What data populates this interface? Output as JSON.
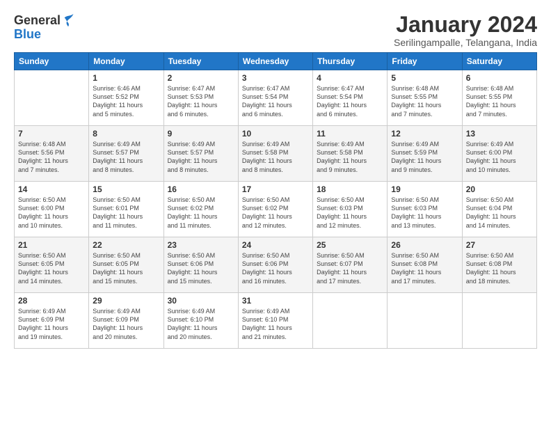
{
  "header": {
    "logo": {
      "general": "General",
      "blue": "Blue"
    },
    "month_title": "January 2024",
    "subtitle": "Serilingampalle, Telangana, India"
  },
  "days_of_week": [
    "Sunday",
    "Monday",
    "Tuesday",
    "Wednesday",
    "Thursday",
    "Friday",
    "Saturday"
  ],
  "weeks": [
    [
      {
        "day": "",
        "info": ""
      },
      {
        "day": "1",
        "info": "Sunrise: 6:46 AM\nSunset: 5:52 PM\nDaylight: 11 hours\nand 5 minutes."
      },
      {
        "day": "2",
        "info": "Sunrise: 6:47 AM\nSunset: 5:53 PM\nDaylight: 11 hours\nand 6 minutes."
      },
      {
        "day": "3",
        "info": "Sunrise: 6:47 AM\nSunset: 5:54 PM\nDaylight: 11 hours\nand 6 minutes."
      },
      {
        "day": "4",
        "info": "Sunrise: 6:47 AM\nSunset: 5:54 PM\nDaylight: 11 hours\nand 6 minutes."
      },
      {
        "day": "5",
        "info": "Sunrise: 6:48 AM\nSunset: 5:55 PM\nDaylight: 11 hours\nand 7 minutes."
      },
      {
        "day": "6",
        "info": "Sunrise: 6:48 AM\nSunset: 5:55 PM\nDaylight: 11 hours\nand 7 minutes."
      }
    ],
    [
      {
        "day": "7",
        "info": "Sunrise: 6:48 AM\nSunset: 5:56 PM\nDaylight: 11 hours\nand 7 minutes."
      },
      {
        "day": "8",
        "info": "Sunrise: 6:49 AM\nSunset: 5:57 PM\nDaylight: 11 hours\nand 8 minutes."
      },
      {
        "day": "9",
        "info": "Sunrise: 6:49 AM\nSunset: 5:57 PM\nDaylight: 11 hours\nand 8 minutes."
      },
      {
        "day": "10",
        "info": "Sunrise: 6:49 AM\nSunset: 5:58 PM\nDaylight: 11 hours\nand 8 minutes."
      },
      {
        "day": "11",
        "info": "Sunrise: 6:49 AM\nSunset: 5:58 PM\nDaylight: 11 hours\nand 9 minutes."
      },
      {
        "day": "12",
        "info": "Sunrise: 6:49 AM\nSunset: 5:59 PM\nDaylight: 11 hours\nand 9 minutes."
      },
      {
        "day": "13",
        "info": "Sunrise: 6:49 AM\nSunset: 6:00 PM\nDaylight: 11 hours\nand 10 minutes."
      }
    ],
    [
      {
        "day": "14",
        "info": "Sunrise: 6:50 AM\nSunset: 6:00 PM\nDaylight: 11 hours\nand 10 minutes."
      },
      {
        "day": "15",
        "info": "Sunrise: 6:50 AM\nSunset: 6:01 PM\nDaylight: 11 hours\nand 11 minutes."
      },
      {
        "day": "16",
        "info": "Sunrise: 6:50 AM\nSunset: 6:02 PM\nDaylight: 11 hours\nand 11 minutes."
      },
      {
        "day": "17",
        "info": "Sunrise: 6:50 AM\nSunset: 6:02 PM\nDaylight: 11 hours\nand 12 minutes."
      },
      {
        "day": "18",
        "info": "Sunrise: 6:50 AM\nSunset: 6:03 PM\nDaylight: 11 hours\nand 12 minutes."
      },
      {
        "day": "19",
        "info": "Sunrise: 6:50 AM\nSunset: 6:03 PM\nDaylight: 11 hours\nand 13 minutes."
      },
      {
        "day": "20",
        "info": "Sunrise: 6:50 AM\nSunset: 6:04 PM\nDaylight: 11 hours\nand 14 minutes."
      }
    ],
    [
      {
        "day": "21",
        "info": "Sunrise: 6:50 AM\nSunset: 6:05 PM\nDaylight: 11 hours\nand 14 minutes."
      },
      {
        "day": "22",
        "info": "Sunrise: 6:50 AM\nSunset: 6:05 PM\nDaylight: 11 hours\nand 15 minutes."
      },
      {
        "day": "23",
        "info": "Sunrise: 6:50 AM\nSunset: 6:06 PM\nDaylight: 11 hours\nand 15 minutes."
      },
      {
        "day": "24",
        "info": "Sunrise: 6:50 AM\nSunset: 6:06 PM\nDaylight: 11 hours\nand 16 minutes."
      },
      {
        "day": "25",
        "info": "Sunrise: 6:50 AM\nSunset: 6:07 PM\nDaylight: 11 hours\nand 17 minutes."
      },
      {
        "day": "26",
        "info": "Sunrise: 6:50 AM\nSunset: 6:08 PM\nDaylight: 11 hours\nand 17 minutes."
      },
      {
        "day": "27",
        "info": "Sunrise: 6:50 AM\nSunset: 6:08 PM\nDaylight: 11 hours\nand 18 minutes."
      }
    ],
    [
      {
        "day": "28",
        "info": "Sunrise: 6:49 AM\nSunset: 6:09 PM\nDaylight: 11 hours\nand 19 minutes."
      },
      {
        "day": "29",
        "info": "Sunrise: 6:49 AM\nSunset: 6:09 PM\nDaylight: 11 hours\nand 20 minutes."
      },
      {
        "day": "30",
        "info": "Sunrise: 6:49 AM\nSunset: 6:10 PM\nDaylight: 11 hours\nand 20 minutes."
      },
      {
        "day": "31",
        "info": "Sunrise: 6:49 AM\nSunset: 6:10 PM\nDaylight: 11 hours\nand 21 minutes."
      },
      {
        "day": "",
        "info": ""
      },
      {
        "day": "",
        "info": ""
      },
      {
        "day": "",
        "info": ""
      }
    ]
  ]
}
